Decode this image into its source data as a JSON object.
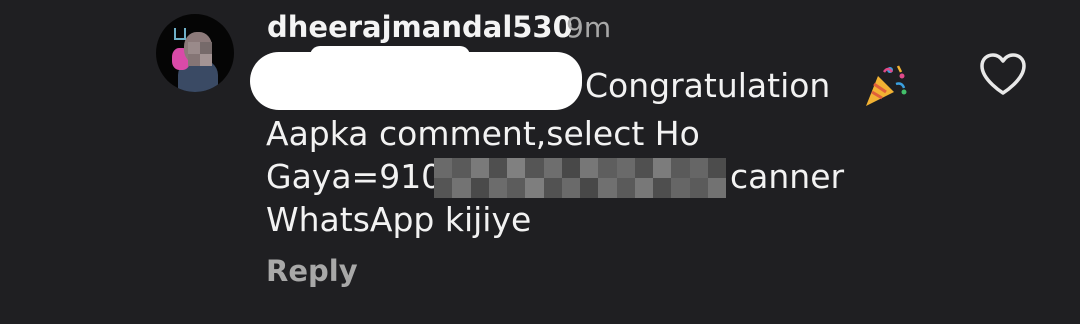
{
  "comment": {
    "username": "dheerajmandal530",
    "time": "9m",
    "text_line1": "Congratulation",
    "text_line2": "Aapka comment,select Ho",
    "text_line3_prefix": "Gaya=910",
    "text_line3_suffix": "canner",
    "text_line4": "WhatsApp kijiye",
    "emoji": "party-popper-icon",
    "reply_label": "Reply"
  },
  "icons": {
    "like": "heart-icon",
    "avatar": "user-avatar"
  },
  "colors": {
    "background": "#1f1f22",
    "text": "#f2f2f2",
    "muted": "#a8a8a8",
    "redaction": "#ffffff"
  }
}
